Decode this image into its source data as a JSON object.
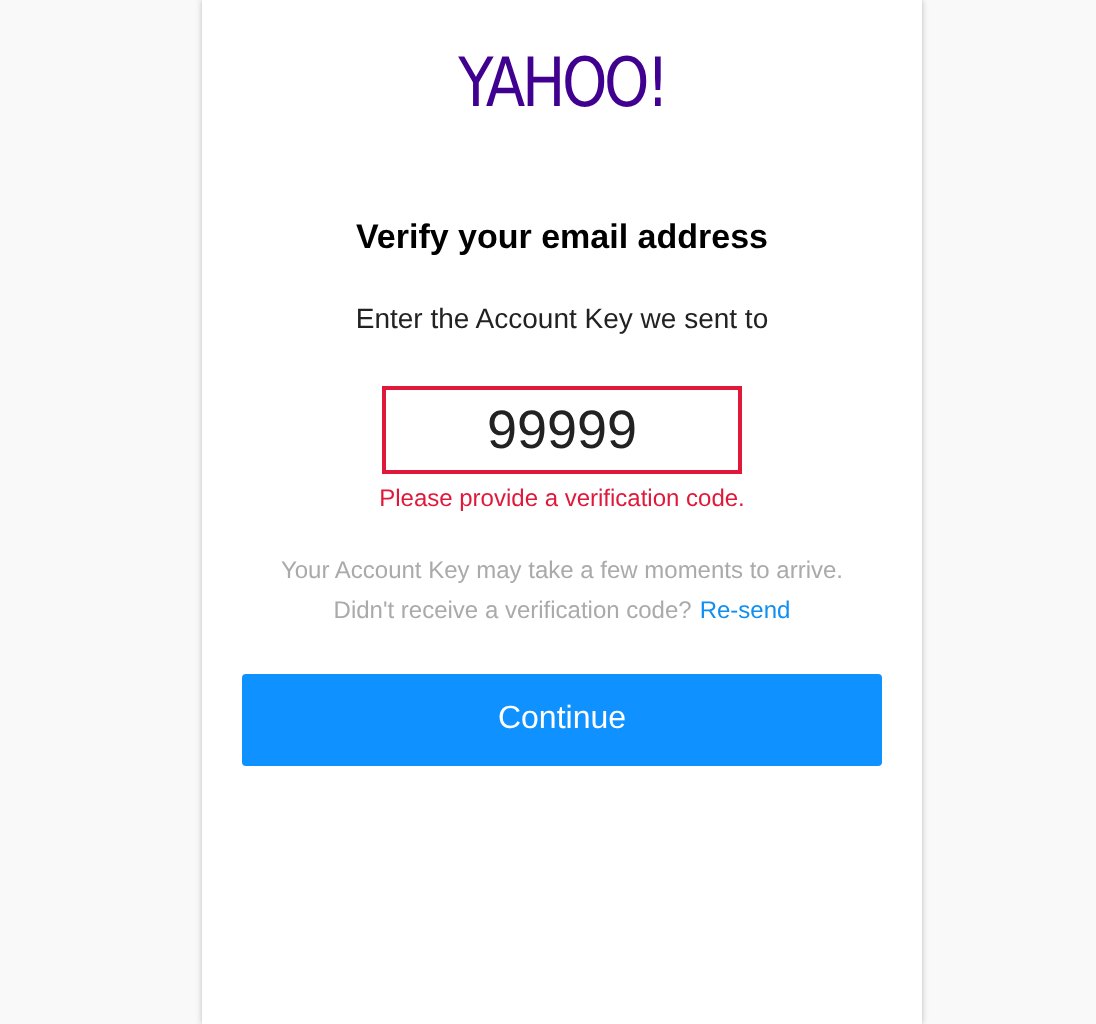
{
  "logo": "YAHOO!",
  "heading": "Verify your email address",
  "instruction": "Enter the Account Key we sent to",
  "code_field": {
    "value": "99999",
    "invalid": true,
    "error": "Please provide a verification code."
  },
  "note": "Your Account Key may take a few moments to arrive.",
  "resend_prompt": "Didn't receive a verification code?",
  "resend_link": "Re-send",
  "continue_button": "Continue"
}
